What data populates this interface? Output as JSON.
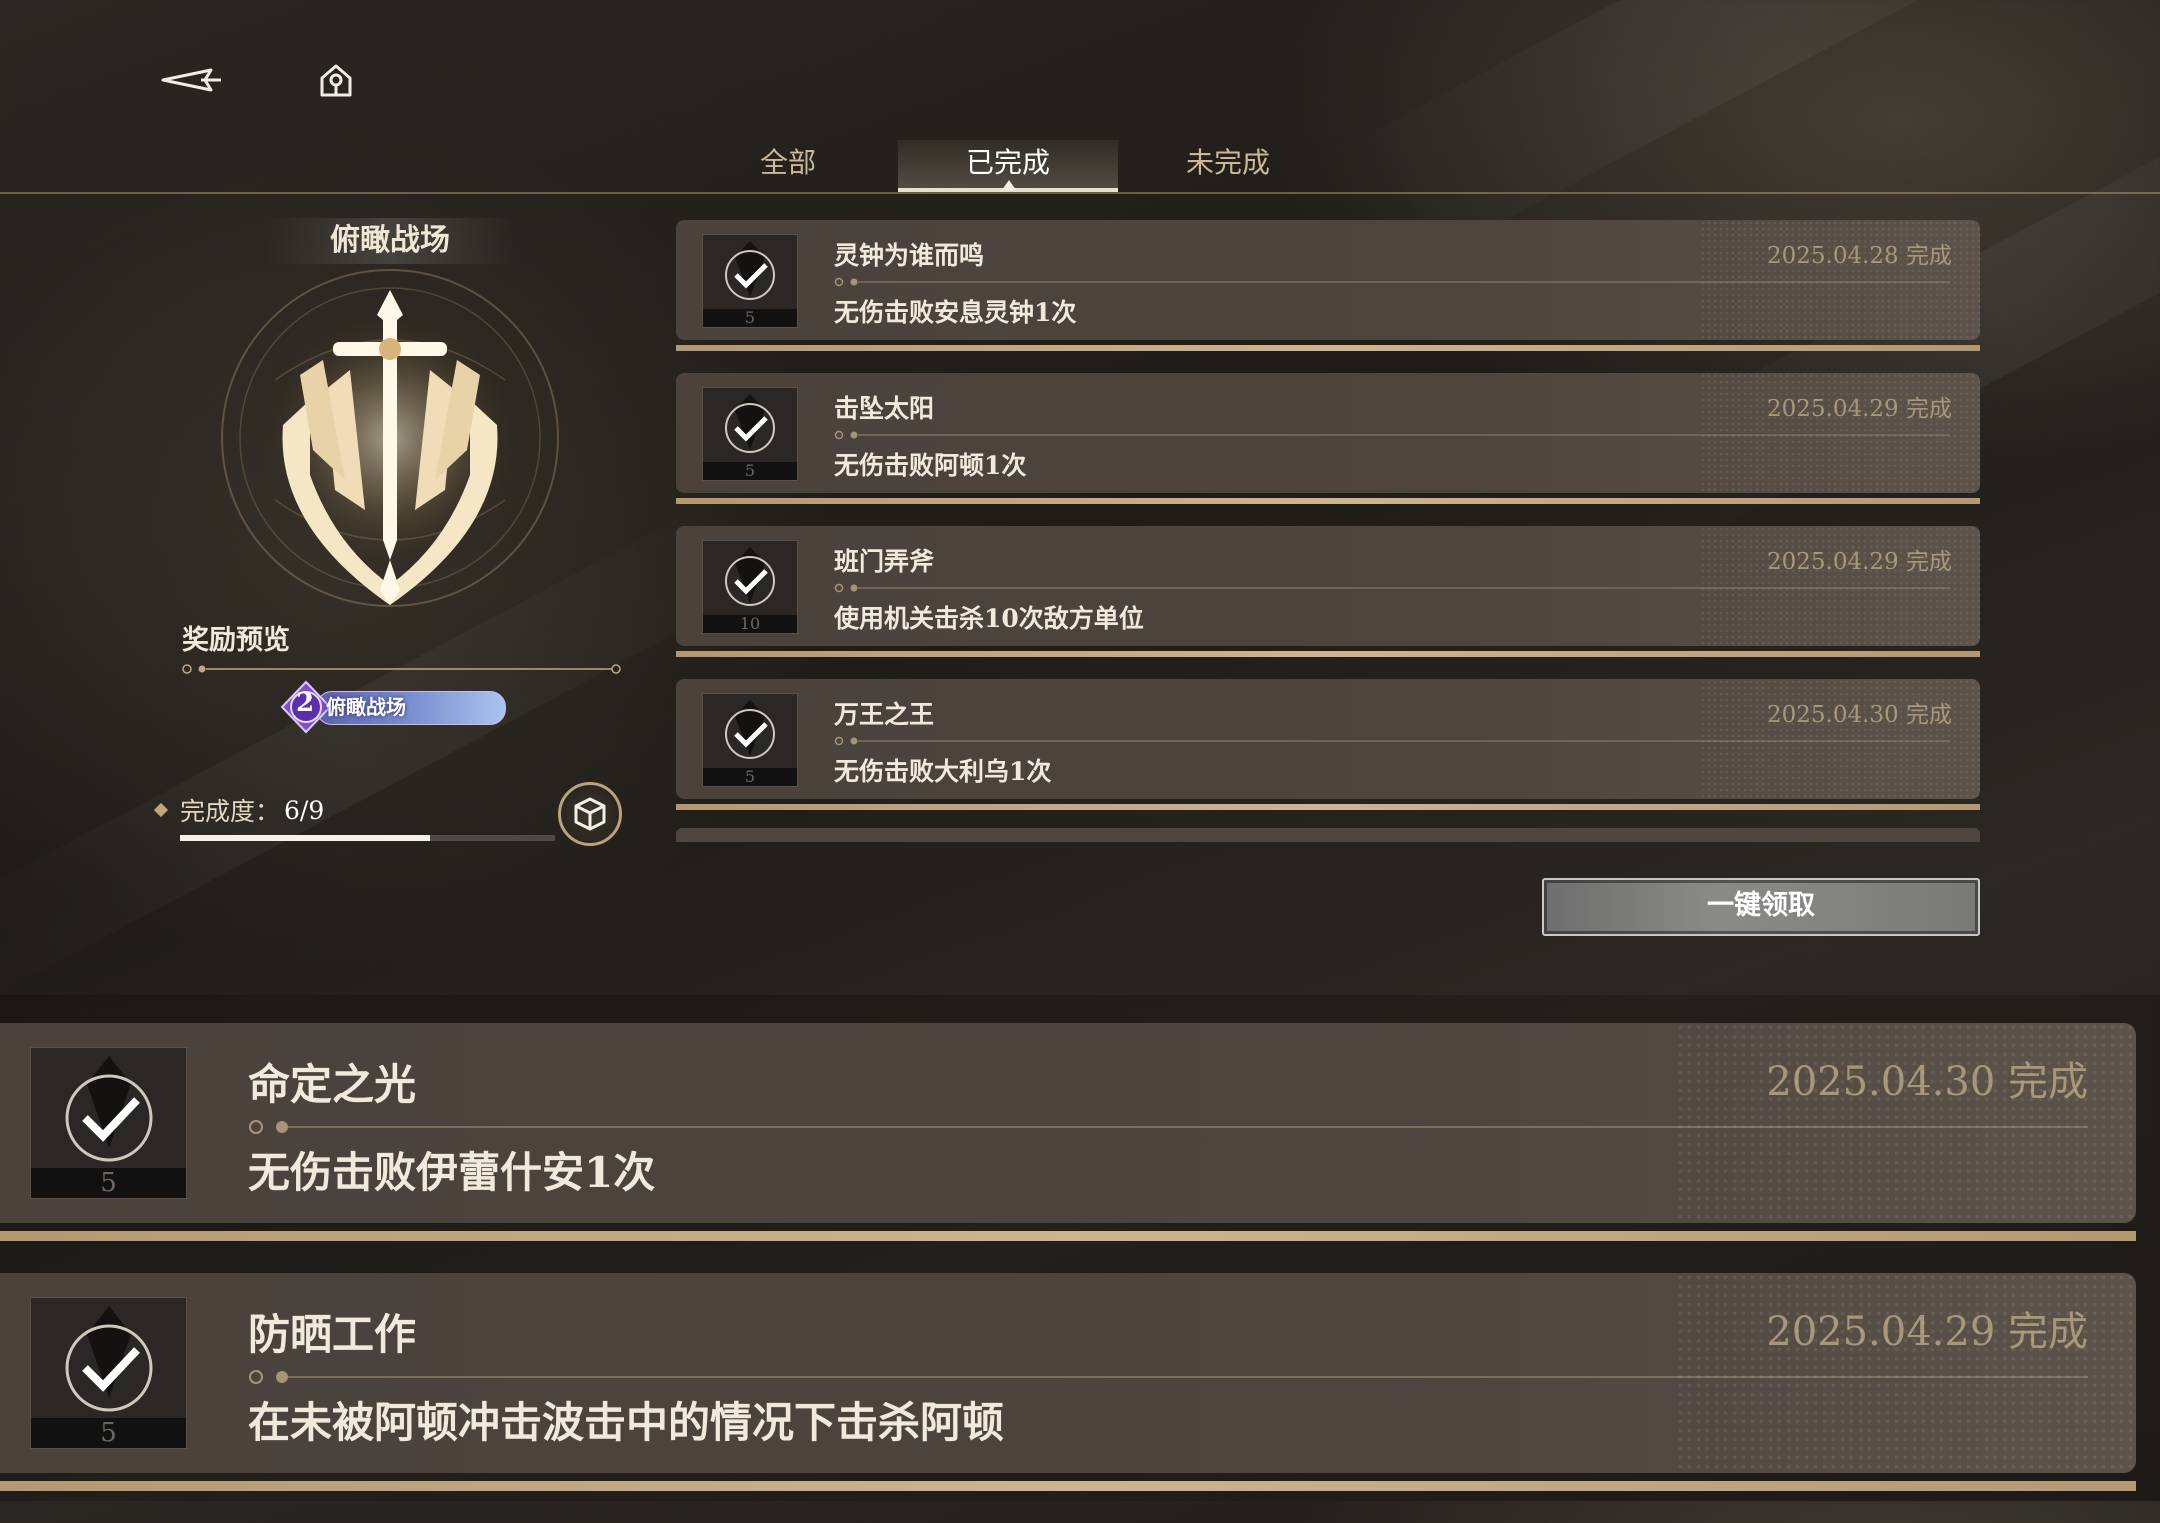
{
  "nav": {
    "back_icon": "back-arrow-icon",
    "home_icon": "home-icon"
  },
  "tabs": [
    {
      "label": "全部",
      "active": false
    },
    {
      "label": "已完成",
      "active": true
    },
    {
      "label": "未完成",
      "active": false
    }
  ],
  "left_panel": {
    "title": "俯瞰战场",
    "emblem_icon": "sword-emblem-icon",
    "reward_preview_label": "奖励预览",
    "reward_badge": {
      "level": "2",
      "name": "俯瞰战场"
    },
    "completion_label": "完成度：",
    "completion_value": "6/9",
    "completion_fraction": 0.667,
    "reward_box_icon": "cube-box-icon"
  },
  "tasks": [
    {
      "name": "灵钟为谁而鸣",
      "date": "2025.04.28 完成",
      "desc": "无伤击败安息灵钟1次",
      "icon_num": "5"
    },
    {
      "name": "击坠太阳",
      "date": "2025.04.29 完成",
      "desc": "无伤击败阿顿1次",
      "icon_num": "5"
    },
    {
      "name": "班门弄斧",
      "date": "2025.04.29 完成",
      "desc": "使用机关击杀10次敌方单位",
      "icon_num": "10"
    },
    {
      "name": "万王之王",
      "date": "2025.04.30 完成",
      "desc": "无伤击败大利乌1次",
      "icon_num": "5"
    }
  ],
  "claim_button": "一键领取",
  "zoomed_tasks": [
    {
      "name": "命定之光",
      "date": "2025.04.30 完成",
      "desc": "无伤击败伊蕾什安1次",
      "icon_num": "5"
    },
    {
      "name": "防晒工作",
      "date": "2025.04.29 完成",
      "desc": "在未被阿顿冲击波击中的情况下击杀阿顿",
      "icon_num": "5"
    }
  ],
  "colors": {
    "accent_gold": "#b39872",
    "date_text": "#a89679",
    "card_bg": "#4a423b"
  }
}
